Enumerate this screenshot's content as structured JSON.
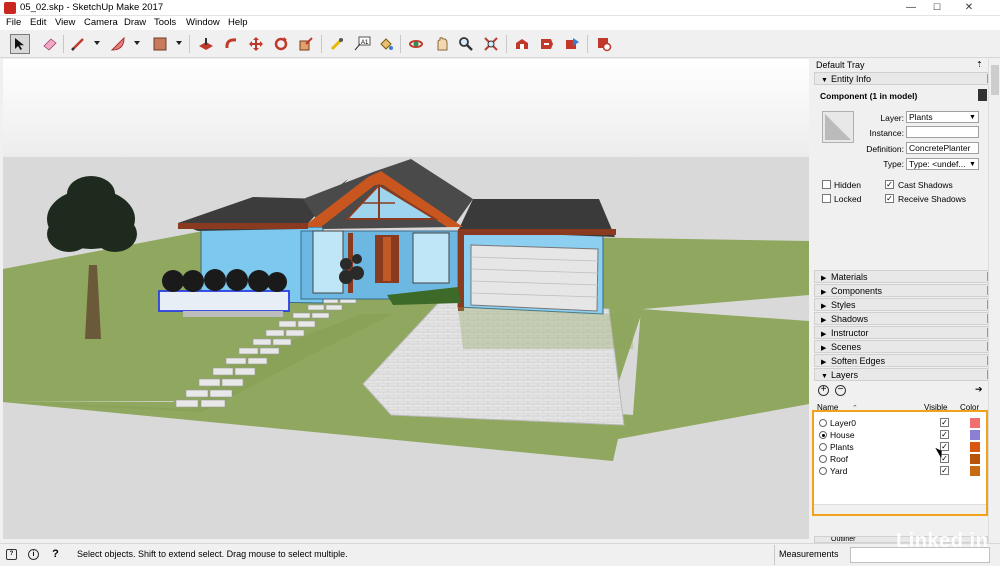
{
  "window": {
    "title": "05_02.skp - SketchUp Make 2017",
    "min": "—",
    "max": "☐",
    "close": "✕"
  },
  "menu": [
    "File",
    "Edit",
    "View",
    "Camera",
    "Draw",
    "Tools",
    "Window",
    "Help"
  ],
  "tray": {
    "title": "Default Tray",
    "entity_info": {
      "header": "Entity Info",
      "component_title": "Component (1 in model)",
      "layer_label": "Layer:",
      "layer_value": "Plants",
      "instance_label": "Instance:",
      "instance_value": "",
      "definition_label": "Definition:",
      "definition_value": "ConcretePlanter",
      "type_label": "Type:",
      "type_value": "Type: <undef...",
      "hidden_label": "Hidden",
      "hidden": false,
      "cast_shadows_label": "Cast Shadows",
      "cast_shadows": true,
      "locked_label": "Locked",
      "locked": false,
      "receive_shadows_label": "Receive Shadows",
      "receive_shadows": true
    },
    "sections": [
      "Materials",
      "Components",
      "Styles",
      "Shadows",
      "Instructor",
      "Scenes",
      "Soften Edges"
    ],
    "layers": {
      "header": "Layers",
      "col_name": "Name",
      "col_visible": "Visible",
      "col_color": "Color",
      "rows": [
        {
          "name": "Layer0",
          "active": false,
          "visible": true,
          "color": "#f07070"
        },
        {
          "name": "House",
          "active": true,
          "visible": true,
          "color": "#8a7fd0"
        },
        {
          "name": "Plants",
          "active": false,
          "visible": true,
          "color": "#d9560f"
        },
        {
          "name": "Roof",
          "active": false,
          "visible": true,
          "color": "#b8540a"
        },
        {
          "name": "Yard",
          "active": false,
          "visible": true,
          "color": "#c86a12"
        }
      ]
    },
    "outliner": "Outliner"
  },
  "status": {
    "text": "Select objects. Shift to extend select. Drag mouse to select multiple.",
    "measurements_label": "Measurements"
  },
  "watermark": "Linked in"
}
